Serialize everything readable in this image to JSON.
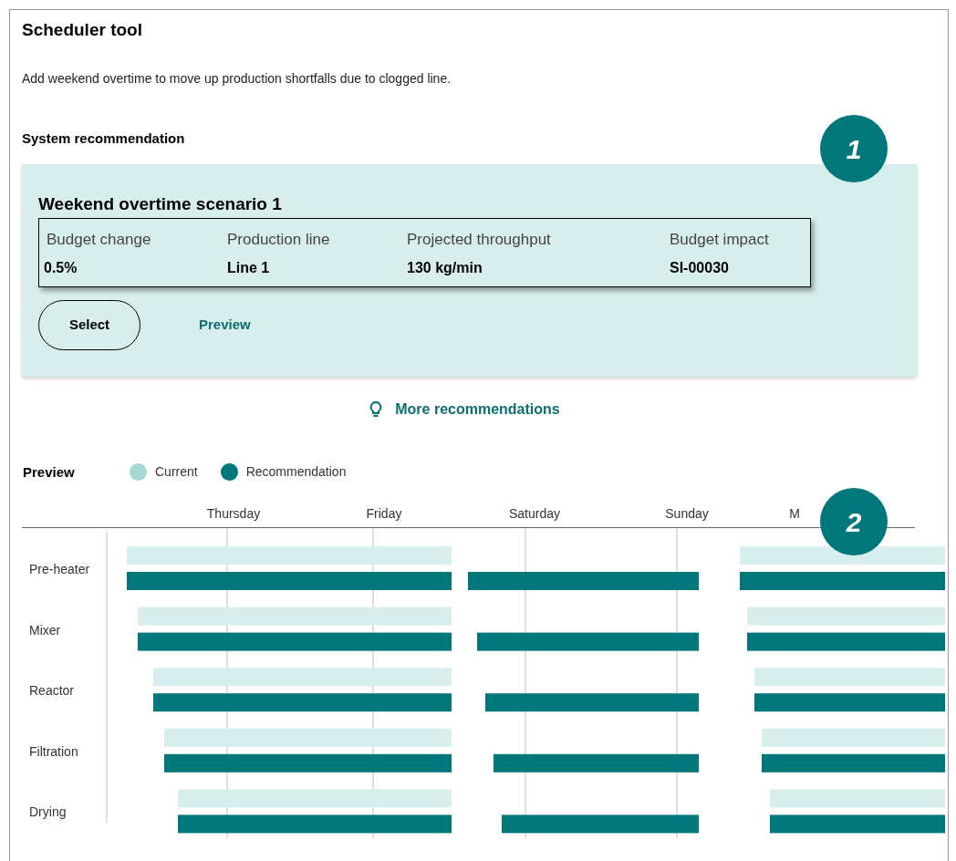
{
  "title": "Scheduler tool",
  "description": "Add weekend overtime to move up production shortfalls due to clogged line.",
  "recommendation": {
    "heading": "System recommendation",
    "scenario_title": "Weekend overtime scenario 1",
    "fields": [
      {
        "label": "Budget change",
        "value": "0.5%"
      },
      {
        "label": "Production line",
        "value": "Line 1"
      },
      {
        "label": "Projected throughput",
        "value": "130 kg/min"
      },
      {
        "label": "Budget impact",
        "value": "SI-00030"
      }
    ],
    "buttons": [
      {
        "label": "Select",
        "kind": "outlined"
      },
      {
        "label": "Preview",
        "kind": "link"
      }
    ]
  },
  "more_link": "More recommendations",
  "preview": {
    "heading": "Preview",
    "legend": [
      {
        "label": "Current",
        "color": "#a3d8d4"
      },
      {
        "label": "Recommendation",
        "color": "#00777a"
      }
    ],
    "days": [
      "Thursday",
      "Friday",
      "Saturday",
      "Sunday",
      "M"
    ],
    "rows": [
      "Pre-heater",
      "Mixer",
      "Reactor",
      "Filtration",
      "Drying"
    ]
  },
  "callouts": [
    "1",
    "2"
  ]
}
